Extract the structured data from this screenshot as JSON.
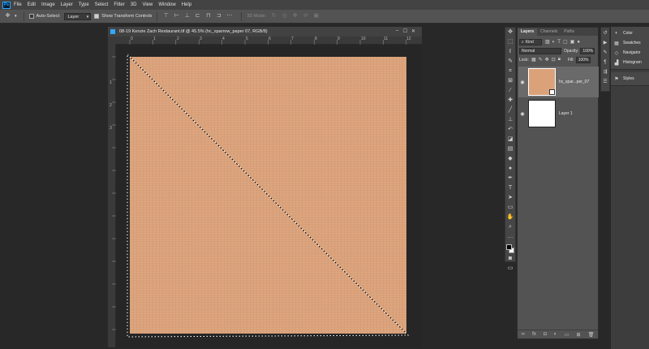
{
  "app": {
    "logo_text": "Ps"
  },
  "menu": [
    "File",
    "Edit",
    "Image",
    "Layer",
    "Type",
    "Select",
    "Filter",
    "3D",
    "View",
    "Window",
    "Help"
  ],
  "options_bar": {
    "auto_select_label": "Auto-Select:",
    "auto_select_target": "Layer",
    "show_transform_label": "Show Transform Controls",
    "show_transform_checked": true,
    "mode_3d_label": "3D Mode:"
  },
  "document": {
    "title": "08-19 Kenzie Zach Restaurant.tif @ 45.5% (hc_sparrow_paper 07, RGB/8)",
    "ruler_h": [
      "0",
      "1",
      "2",
      "3",
      "4",
      "5",
      "6",
      "7",
      "8",
      "9",
      "10",
      "11",
      "12"
    ],
    "ruler_v": [
      "1",
      "2",
      "3"
    ],
    "paper_color": "#dba27a"
  },
  "tools": [
    "move-icon",
    "marquee-icon",
    "lasso-icon",
    "quick-select-icon",
    "crop-icon",
    "frame-icon",
    "eyedropper-icon",
    "healing-icon",
    "brush-icon",
    "stamp-icon",
    "history-brush-icon",
    "eraser-icon",
    "gradient-icon",
    "blur-icon",
    "dodge-icon",
    "pen-icon",
    "type-icon",
    "path-select-icon",
    "shape-icon",
    "hand-icon",
    "zoom-icon",
    "more-icon"
  ],
  "layers_panel": {
    "tabs": [
      "Layers",
      "Channels",
      "Paths"
    ],
    "active_tab": "Layers",
    "filter_label": "Kind",
    "blend_mode": "Normal",
    "opacity_label": "Opacity:",
    "opacity_value": "100%",
    "lock_label": "Lock:",
    "fill_label": "Fill:",
    "fill_value": "100%",
    "layers": [
      {
        "name": "hc_spar...per_07",
        "selected": true,
        "visible": true,
        "thumb_color": "#dba27a"
      },
      {
        "name": "Layer 1",
        "selected": false,
        "visible": true,
        "thumb_color": "#ffffff"
      }
    ]
  },
  "right_panels": {
    "group1": [
      {
        "icon": "color-icon",
        "label": "Color"
      },
      {
        "icon": "swatches-icon",
        "label": "Swatches"
      },
      {
        "icon": "navigator-icon",
        "label": "Navigator"
      },
      {
        "icon": "histogram-icon",
        "label": "Histogram"
      }
    ],
    "group2": [
      {
        "icon": "styles-icon",
        "label": "Styles"
      }
    ]
  }
}
